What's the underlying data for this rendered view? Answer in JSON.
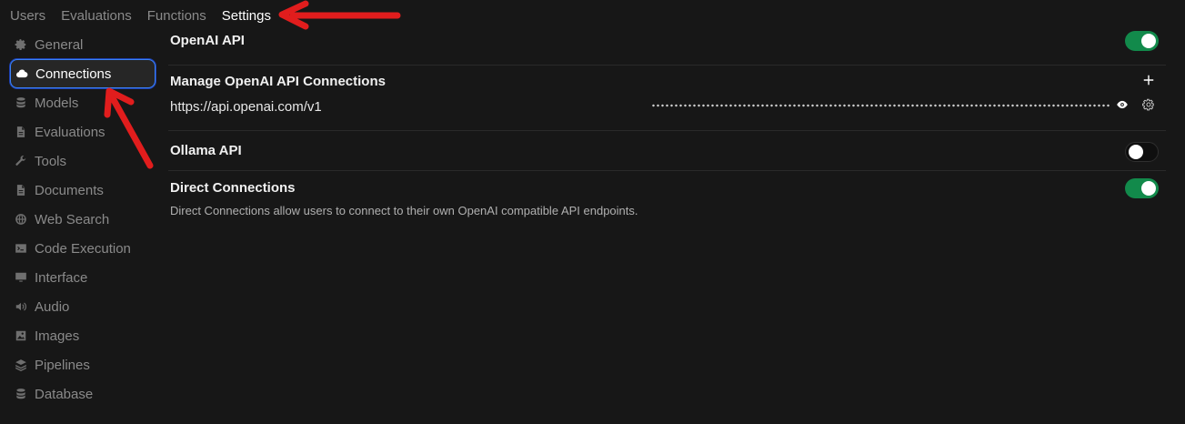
{
  "top_tabs": [
    {
      "label": "Users"
    },
    {
      "label": "Evaluations"
    },
    {
      "label": "Functions"
    },
    {
      "label": "Settings"
    }
  ],
  "sidebar": {
    "items": [
      {
        "label": "General",
        "icon": "gear-icon"
      },
      {
        "label": "Connections",
        "icon": "cloud-icon"
      },
      {
        "label": "Models",
        "icon": "database-icon"
      },
      {
        "label": "Evaluations",
        "icon": "document-icon"
      },
      {
        "label": "Tools",
        "icon": "wrench-icon"
      },
      {
        "label": "Documents",
        "icon": "document-icon"
      },
      {
        "label": "Web Search",
        "icon": "globe-icon"
      },
      {
        "label": "Code Execution",
        "icon": "terminal-icon"
      },
      {
        "label": "Interface",
        "icon": "monitor-icon"
      },
      {
        "label": "Audio",
        "icon": "speaker-icon"
      },
      {
        "label": "Images",
        "icon": "image-icon"
      },
      {
        "label": "Pipelines",
        "icon": "layers-icon"
      },
      {
        "label": "Database",
        "icon": "database-icon"
      }
    ],
    "active": "Connections"
  },
  "main": {
    "openai": {
      "title": "OpenAI API",
      "enabled": true
    },
    "manage": {
      "title": "Manage OpenAI API Connections",
      "url": "https://api.openai.com/v1"
    },
    "ollama": {
      "title": "Ollama API",
      "enabled": false
    },
    "direct": {
      "title": "Direct Connections",
      "description": "Direct Connections allow users to connect to their own OpenAI compatible API endpoints.",
      "enabled": true
    }
  },
  "colors": {
    "background": "#171717",
    "toggle_on": "#128a4b",
    "active_border": "#3b82f6",
    "annotation_arrow": "#e11d1d"
  }
}
